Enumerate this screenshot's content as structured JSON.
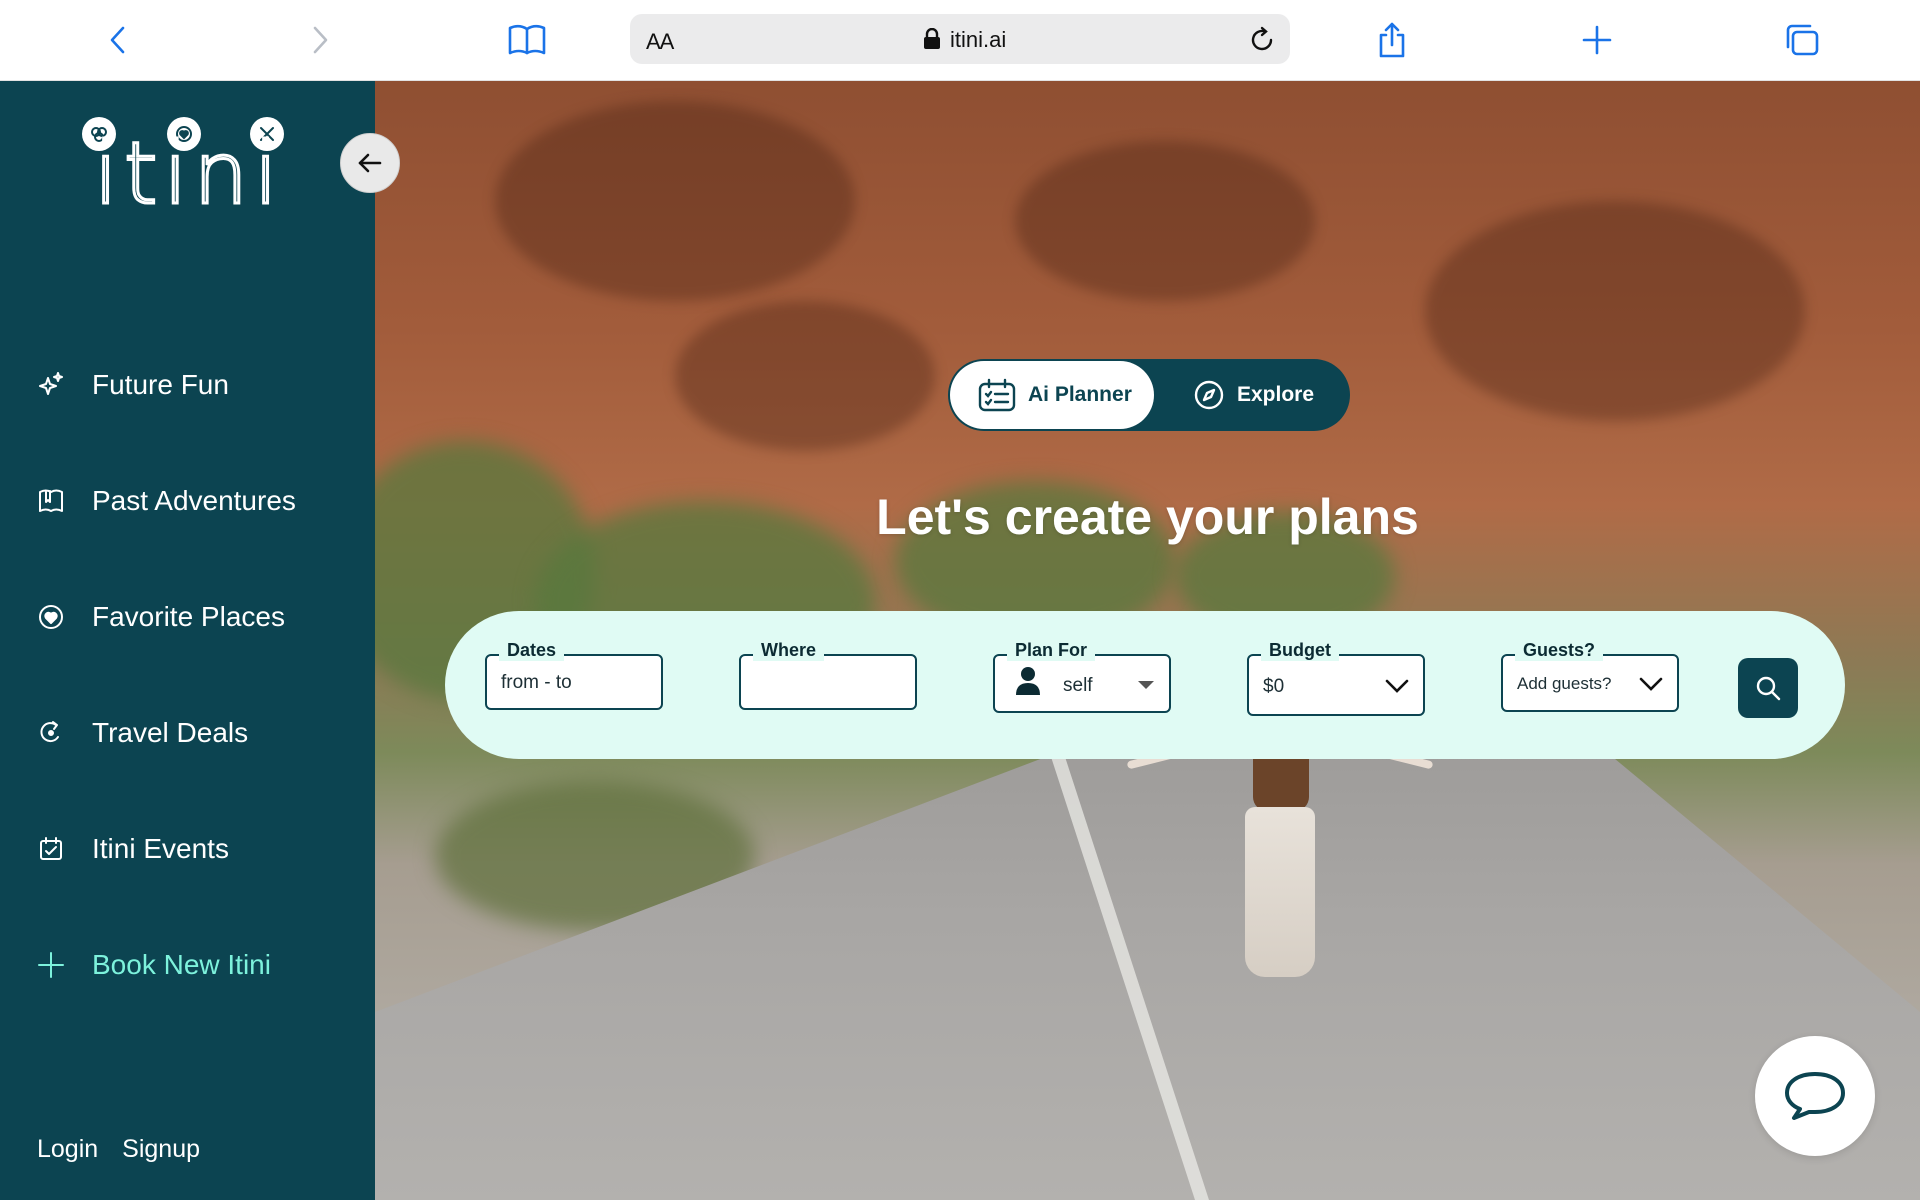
{
  "browser": {
    "text_size_label": "AA",
    "url": "itini.ai",
    "icons": [
      "back-icon",
      "forward-icon",
      "bookmarks-icon",
      "lock-icon",
      "reload-icon",
      "share-icon",
      "new-tab-icon",
      "tabs-icon"
    ],
    "accent_color": "#1a73e8"
  },
  "sidebar": {
    "background_color": "#0c4451",
    "logo_text": "itini",
    "items": [
      {
        "label": "Future Fun",
        "icon": "sparkles-icon"
      },
      {
        "label": "Past Adventures",
        "icon": "bookmark-book-icon"
      },
      {
        "label": "Favorite Places",
        "icon": "heart-circle-icon"
      },
      {
        "label": "Travel Deals",
        "icon": "tag-deal-icon"
      },
      {
        "label": "Itini Events",
        "icon": "calendar-check-icon"
      },
      {
        "label": "Book New Itini",
        "icon": "plus-icon",
        "color": "#7df2dc"
      }
    ],
    "login_label": "Login",
    "signup_label": "Signup"
  },
  "hero": {
    "mode_tabs": [
      {
        "label": "Ai Planner",
        "icon": "planner-icon",
        "active": true
      },
      {
        "label": "Explore",
        "icon": "compass-icon",
        "active": false
      }
    ],
    "headline": "Let's create your plans",
    "search": {
      "dates": {
        "label": "Dates",
        "value": "from - to"
      },
      "where": {
        "label": "Where",
        "value": ""
      },
      "plan_for": {
        "label": "Plan For",
        "value": "self"
      },
      "budget": {
        "label": "Budget",
        "value": "$0"
      },
      "guests": {
        "label": "Guests?",
        "value": "Add guests?"
      }
    }
  }
}
